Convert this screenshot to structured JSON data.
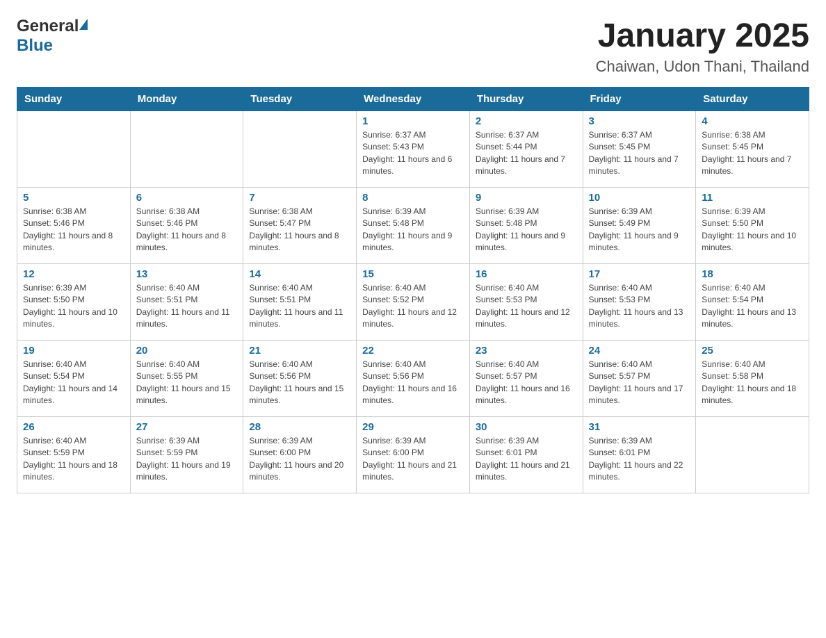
{
  "header": {
    "logo_general": "General",
    "logo_blue": "Blue",
    "title": "January 2025",
    "subtitle": "Chaiwan, Udon Thani, Thailand"
  },
  "calendar": {
    "days_of_week": [
      "Sunday",
      "Monday",
      "Tuesday",
      "Wednesday",
      "Thursday",
      "Friday",
      "Saturday"
    ],
    "weeks": [
      [
        {
          "day": "",
          "info": ""
        },
        {
          "day": "",
          "info": ""
        },
        {
          "day": "",
          "info": ""
        },
        {
          "day": "1",
          "info": "Sunrise: 6:37 AM\nSunset: 5:43 PM\nDaylight: 11 hours and 6 minutes."
        },
        {
          "day": "2",
          "info": "Sunrise: 6:37 AM\nSunset: 5:44 PM\nDaylight: 11 hours and 7 minutes."
        },
        {
          "day": "3",
          "info": "Sunrise: 6:37 AM\nSunset: 5:45 PM\nDaylight: 11 hours and 7 minutes."
        },
        {
          "day": "4",
          "info": "Sunrise: 6:38 AM\nSunset: 5:45 PM\nDaylight: 11 hours and 7 minutes."
        }
      ],
      [
        {
          "day": "5",
          "info": "Sunrise: 6:38 AM\nSunset: 5:46 PM\nDaylight: 11 hours and 8 minutes."
        },
        {
          "day": "6",
          "info": "Sunrise: 6:38 AM\nSunset: 5:46 PM\nDaylight: 11 hours and 8 minutes."
        },
        {
          "day": "7",
          "info": "Sunrise: 6:38 AM\nSunset: 5:47 PM\nDaylight: 11 hours and 8 minutes."
        },
        {
          "day": "8",
          "info": "Sunrise: 6:39 AM\nSunset: 5:48 PM\nDaylight: 11 hours and 9 minutes."
        },
        {
          "day": "9",
          "info": "Sunrise: 6:39 AM\nSunset: 5:48 PM\nDaylight: 11 hours and 9 minutes."
        },
        {
          "day": "10",
          "info": "Sunrise: 6:39 AM\nSunset: 5:49 PM\nDaylight: 11 hours and 9 minutes."
        },
        {
          "day": "11",
          "info": "Sunrise: 6:39 AM\nSunset: 5:50 PM\nDaylight: 11 hours and 10 minutes."
        }
      ],
      [
        {
          "day": "12",
          "info": "Sunrise: 6:39 AM\nSunset: 5:50 PM\nDaylight: 11 hours and 10 minutes."
        },
        {
          "day": "13",
          "info": "Sunrise: 6:40 AM\nSunset: 5:51 PM\nDaylight: 11 hours and 11 minutes."
        },
        {
          "day": "14",
          "info": "Sunrise: 6:40 AM\nSunset: 5:51 PM\nDaylight: 11 hours and 11 minutes."
        },
        {
          "day": "15",
          "info": "Sunrise: 6:40 AM\nSunset: 5:52 PM\nDaylight: 11 hours and 12 minutes."
        },
        {
          "day": "16",
          "info": "Sunrise: 6:40 AM\nSunset: 5:53 PM\nDaylight: 11 hours and 12 minutes."
        },
        {
          "day": "17",
          "info": "Sunrise: 6:40 AM\nSunset: 5:53 PM\nDaylight: 11 hours and 13 minutes."
        },
        {
          "day": "18",
          "info": "Sunrise: 6:40 AM\nSunset: 5:54 PM\nDaylight: 11 hours and 13 minutes."
        }
      ],
      [
        {
          "day": "19",
          "info": "Sunrise: 6:40 AM\nSunset: 5:54 PM\nDaylight: 11 hours and 14 minutes."
        },
        {
          "day": "20",
          "info": "Sunrise: 6:40 AM\nSunset: 5:55 PM\nDaylight: 11 hours and 15 minutes."
        },
        {
          "day": "21",
          "info": "Sunrise: 6:40 AM\nSunset: 5:56 PM\nDaylight: 11 hours and 15 minutes."
        },
        {
          "day": "22",
          "info": "Sunrise: 6:40 AM\nSunset: 5:56 PM\nDaylight: 11 hours and 16 minutes."
        },
        {
          "day": "23",
          "info": "Sunrise: 6:40 AM\nSunset: 5:57 PM\nDaylight: 11 hours and 16 minutes."
        },
        {
          "day": "24",
          "info": "Sunrise: 6:40 AM\nSunset: 5:57 PM\nDaylight: 11 hours and 17 minutes."
        },
        {
          "day": "25",
          "info": "Sunrise: 6:40 AM\nSunset: 5:58 PM\nDaylight: 11 hours and 18 minutes."
        }
      ],
      [
        {
          "day": "26",
          "info": "Sunrise: 6:40 AM\nSunset: 5:59 PM\nDaylight: 11 hours and 18 minutes."
        },
        {
          "day": "27",
          "info": "Sunrise: 6:39 AM\nSunset: 5:59 PM\nDaylight: 11 hours and 19 minutes."
        },
        {
          "day": "28",
          "info": "Sunrise: 6:39 AM\nSunset: 6:00 PM\nDaylight: 11 hours and 20 minutes."
        },
        {
          "day": "29",
          "info": "Sunrise: 6:39 AM\nSunset: 6:00 PM\nDaylight: 11 hours and 21 minutes."
        },
        {
          "day": "30",
          "info": "Sunrise: 6:39 AM\nSunset: 6:01 PM\nDaylight: 11 hours and 21 minutes."
        },
        {
          "day": "31",
          "info": "Sunrise: 6:39 AM\nSunset: 6:01 PM\nDaylight: 11 hours and 22 minutes."
        },
        {
          "day": "",
          "info": ""
        }
      ]
    ]
  }
}
